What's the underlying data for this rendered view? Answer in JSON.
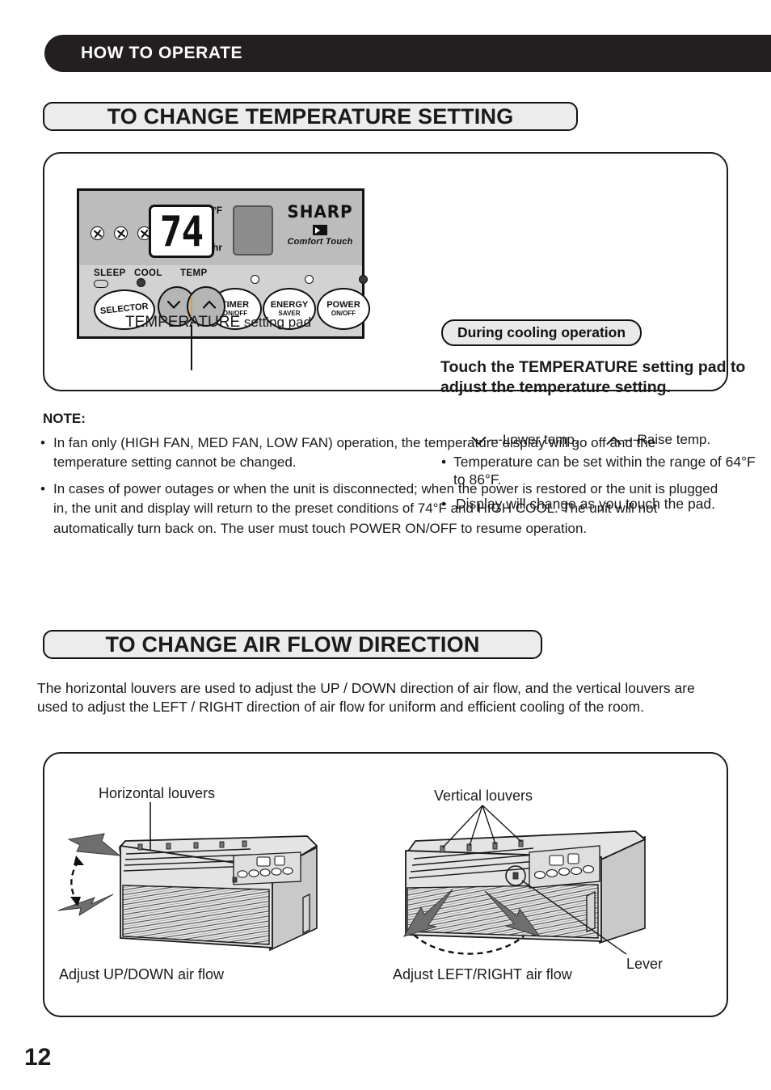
{
  "page": {
    "number": "12",
    "running_head": "HOW TO OPERATE"
  },
  "section_temperature": {
    "title": "TO CHANGE TEMPERATURE SETTING",
    "callout_badge": "During cooling operation",
    "lede": "Touch the TEMPERATURE setting pad to adjust the temperature setting.",
    "arrow_down_label": "---Lower temp.",
    "arrow_up_label": "---Raise temp.",
    "bullets": [
      "Temperature can be set within the range of 64°F to 86°F.",
      "Display will change as you touch the pad."
    ],
    "pad_caption_strong": "TEMPERATURE",
    "pad_caption_rest": " setting pad"
  },
  "control_panel": {
    "display_value": "74",
    "unit_top": "°F",
    "unit_bottom": "hr",
    "brand": "SHARP",
    "brand_tagline": "Comfort Touch",
    "indicator_labels": [
      "SLEEP",
      "COOL",
      "TEMP"
    ],
    "buttons": [
      {
        "line1": "SELECTOR",
        "line2": ""
      },
      {
        "line1": "TIMER",
        "line2": "ON/OFF"
      },
      {
        "line1": "ENERGY",
        "line2": "SAVER"
      },
      {
        "line1": "POWER",
        "line2": "ON/OFF"
      }
    ],
    "fan_icon_count": 3
  },
  "note": {
    "heading": "NOTE:",
    "items": [
      "In fan only (HIGH FAN, MED FAN, LOW FAN) operation, the temperature display will go off and the temperature setting cannot be changed.",
      "In cases of power outages or when the unit is disconnected; when the power is restored or the unit is plugged in, the unit and display will return to the preset conditions of 74°F and HIGH COOL. The unit will not automatically turn back on.  The user must touch POWER ON/OFF to resume operation."
    ]
  },
  "section_airflow": {
    "title": "TO CHANGE AIR FLOW DIRECTION",
    "intro": "The horizontal louvers are used to adjust the UP / DOWN direction of air flow, and the vertical louvers are used to adjust the LEFT / RIGHT direction of air flow for uniform and efficient  cooling of  the  room.",
    "labels": {
      "horizontal_louvers": "Horizontal louvers",
      "vertical_louvers": "Vertical louvers",
      "lever": "Lever",
      "caption_left": "Adjust UP/DOWN air flow",
      "caption_right": "Adjust LEFT/RIGHT air flow"
    }
  },
  "colors": {
    "header_bar": "#231f20",
    "pill_fill": "#ececec",
    "panel_border": "#1a1a1a",
    "unit_body": "#e2e2e2",
    "arrow_gray": "#6e6e6e",
    "pad_gray": "#b5b5b5"
  }
}
